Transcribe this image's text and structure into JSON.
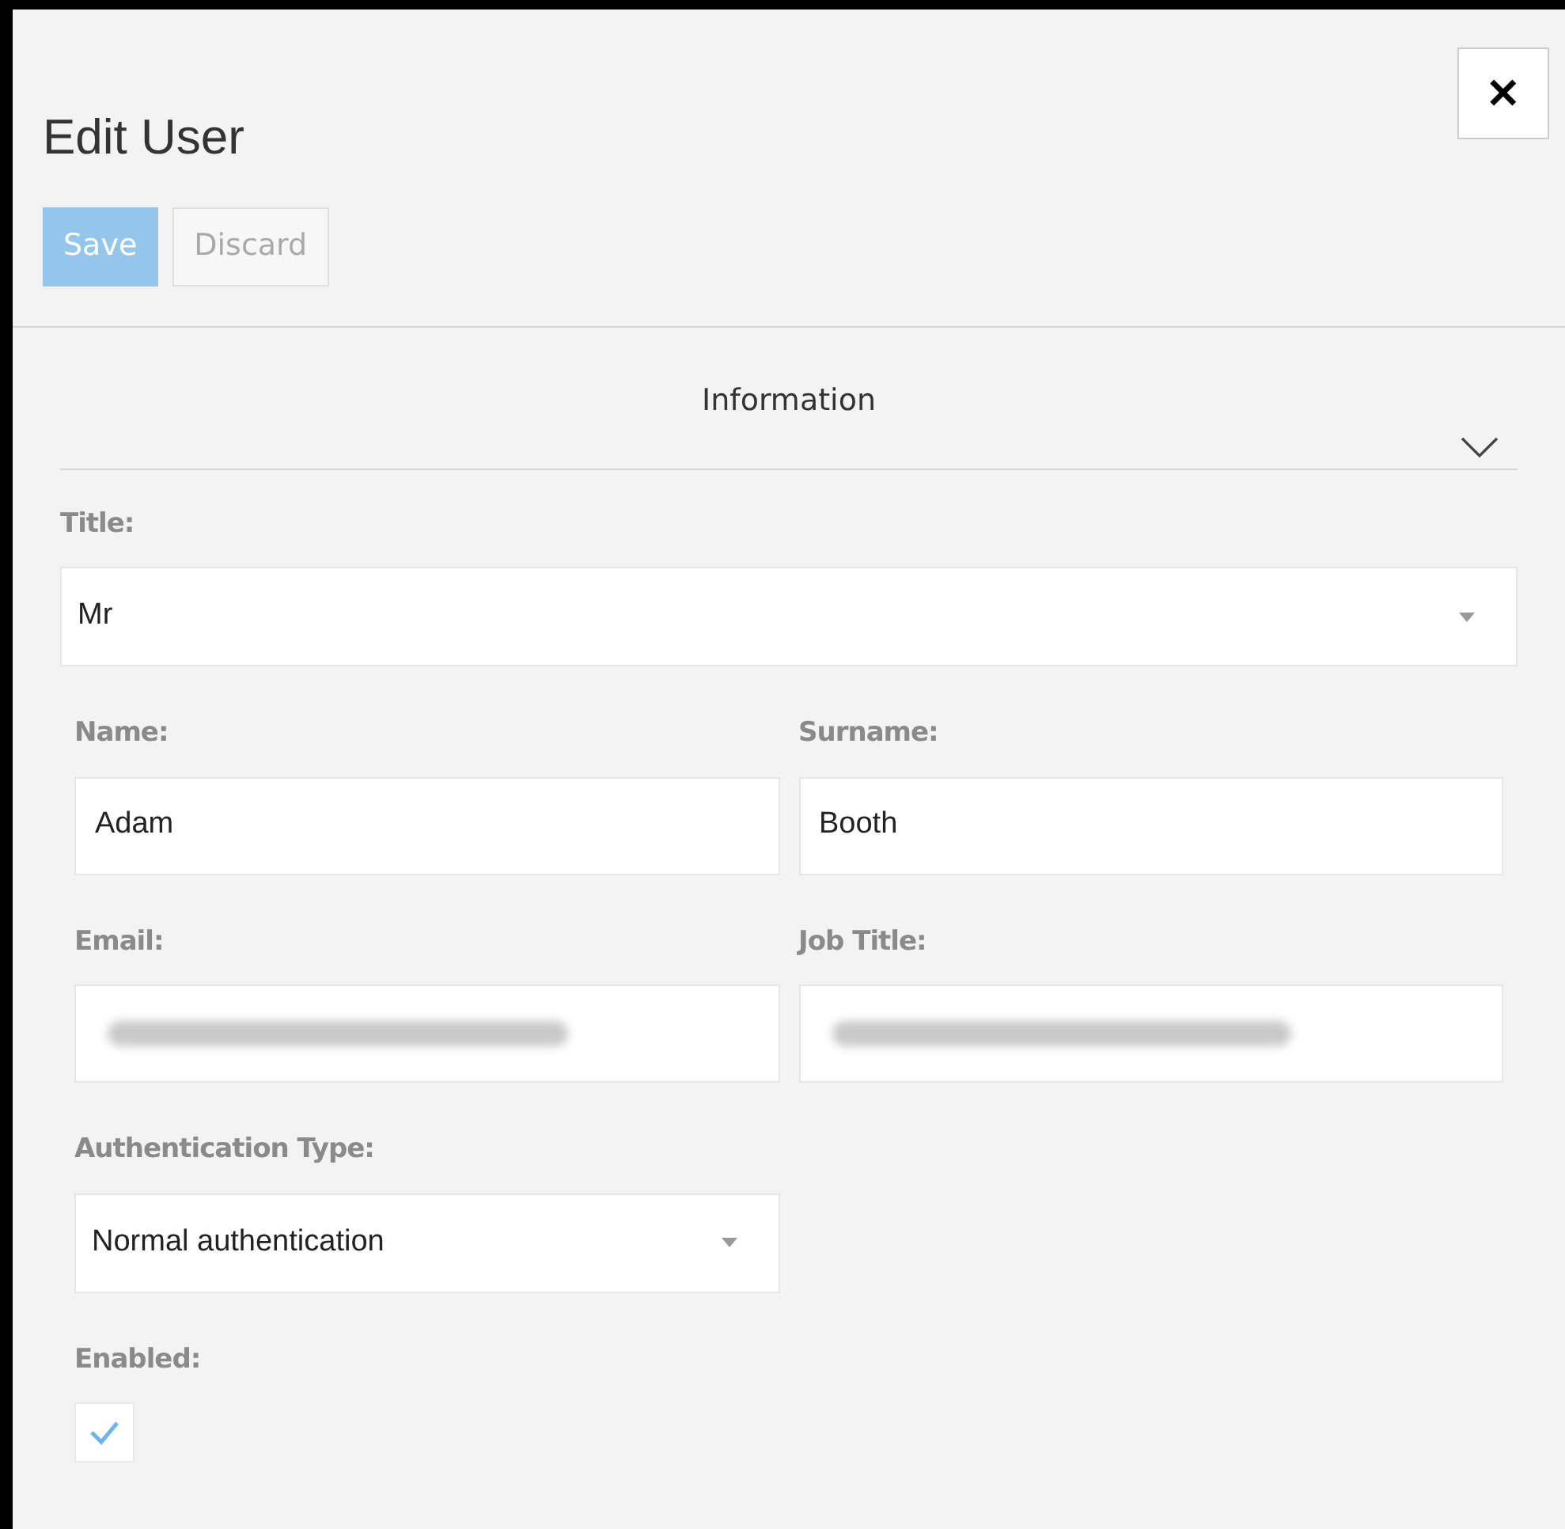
{
  "dialog": {
    "title": "Edit User",
    "close_label": "✕"
  },
  "toolbar": [
    {
      "label": "Save",
      "disabled": true,
      "kind": "primary"
    },
    {
      "label": "Discard",
      "disabled": false,
      "kind": "secondary"
    }
  ],
  "section": {
    "title": "Information",
    "expanded": true
  },
  "title_field": {
    "kind": "select",
    "label": "Title:",
    "value": "Mr"
  },
  "fields": [
    {
      "kind": "text",
      "label": "Name:",
      "value": "Adam"
    },
    {
      "kind": "text",
      "label": "Surname:",
      "value": "Booth"
    },
    {
      "kind": "redacted",
      "label": "Email:"
    },
    {
      "kind": "redacted",
      "label": "Job Title:"
    },
    {
      "kind": "select",
      "label": "Authentication Type:",
      "value": "Normal authentication"
    },
    {
      "kind": "checkbox",
      "label": "Enabled:",
      "checked": true
    }
  ]
}
